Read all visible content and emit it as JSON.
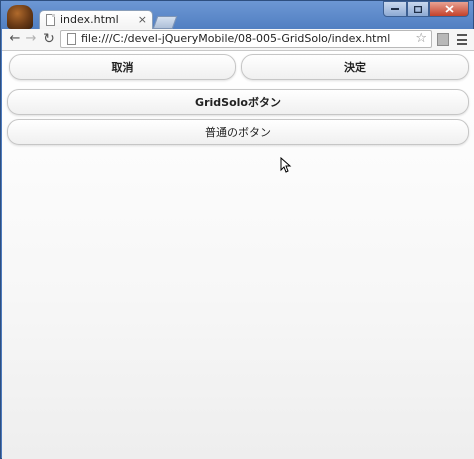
{
  "browser": {
    "tab_title": "index.html",
    "tab_close": "×",
    "url": "file:///C:/devel-jQueryMobile/08-005-GridSolo/index.html"
  },
  "page": {
    "cancel_label": "取消",
    "decide_label": "決定",
    "gridsolo_label": "GridSoloボタン",
    "normal_label": "普通のボタン"
  },
  "colors": {
    "window_frame": "#5a86c6",
    "page_background": "#f7f7f7"
  }
}
